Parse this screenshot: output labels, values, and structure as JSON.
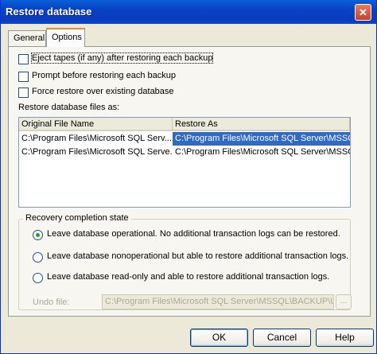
{
  "window": {
    "title": "Restore database",
    "close_glyph": "✕"
  },
  "tabs": [
    {
      "label": "General",
      "active": false
    },
    {
      "label": "Options",
      "active": true
    }
  ],
  "options": {
    "checkboxes": [
      {
        "label": "Eject tapes (if any) after restoring each backup",
        "checked": false
      },
      {
        "label": "Prompt before restoring each backup",
        "checked": false
      },
      {
        "label": "Force restore over existing database",
        "checked": false
      }
    ],
    "files_label": "Restore database files as:",
    "files_table": {
      "columns": [
        "Original File Name",
        "Restore As"
      ],
      "rows": [
        {
          "original": "C:\\Program Files\\Microsoft SQL Serv...",
          "restore_as": "C:\\Program Files\\Microsoft SQL Server\\MSSQ...",
          "selected": true
        },
        {
          "original": "C:\\Program Files\\Microsoft SQL Serve...",
          "restore_as": "C:\\Program Files\\Microsoft SQL Server\\MSSQ...",
          "selected": false
        }
      ]
    },
    "recovery": {
      "title": "Recovery completion state",
      "options": [
        {
          "label": "Leave database operational. No additional transaction logs can be restored.",
          "selected": true
        },
        {
          "label": "Leave database nonoperational but able to restore additional transaction logs.",
          "selected": false
        },
        {
          "label": "Leave database read-only and able to restore additional transaction logs.",
          "selected": false
        }
      ],
      "undo_label": "Undo file:",
      "undo_value": "C:\\Program Files\\Microsoft SQL Server\\MSSQL\\BACKUP\\UN",
      "browse_label": "..."
    }
  },
  "buttons": {
    "ok": "OK",
    "cancel": "Cancel",
    "help": "Help"
  },
  "colors": {
    "title_bar": "#0a46c8",
    "selection": "#316ac5",
    "dialog_bg": "#ece9d8"
  }
}
